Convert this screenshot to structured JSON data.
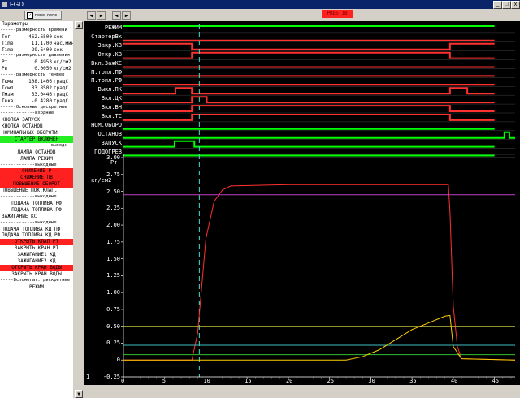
{
  "window": {
    "title": "FGD",
    "minimize": "_",
    "maximize": "□",
    "close": "x"
  },
  "toolbar": {
    "check_label": "none none",
    "check_mark": "✓",
    "nav_prev": "◀",
    "nav_next": "▶",
    "alarm": "PRES 1B"
  },
  "params": [
    {
      "t": "text",
      "text": "Параметры"
    },
    {
      "t": "sep",
      "text": "------размерность времени"
    },
    {
      "t": "kv",
      "label": "Тег",
      "value": "462.6500",
      "unit": "сек"
    },
    {
      "t": "kv",
      "label": "Time",
      "value": "11.1700",
      "unit": "час.мин"
    },
    {
      "t": "kv",
      "label": "Time",
      "value": "29.6400",
      "unit": "сек"
    },
    {
      "t": "sep",
      "text": "------размерность давления"
    },
    {
      "t": "kv",
      "label": "Pт",
      "value": "0.4953",
      "unit": "кг/см2"
    },
    {
      "t": "kv",
      "label": "Pв",
      "value": "0.0050",
      "unit": "кг/см2"
    },
    {
      "t": "sep",
      "text": "------размерность темпер"
    },
    {
      "t": "kv",
      "label": "Ткмз",
      "value": "108.1406",
      "unit": "градС"
    },
    {
      "t": "kv",
      "label": "Тсмл",
      "value": "33.8502",
      "unit": "градС"
    },
    {
      "t": "kv",
      "label": "Тмзм",
      "value": "53.0446",
      "unit": "градС"
    },
    {
      "t": "kv",
      "label": "Твкз",
      "value": "-0.4280",
      "unit": "градС"
    },
    {
      "t": "sep",
      "text": "------Основные дискретные"
    },
    {
      "t": "sep",
      "text": "-------------входные"
    },
    {
      "t": "text",
      "text": "КНОПКА         ЗАПУСК"
    },
    {
      "t": "text",
      "text": "КНОПКА         ОСТАНОВ"
    },
    {
      "t": "text",
      "text": "НОМИНАЛЬНЫХ ОБОРОТИ"
    },
    {
      "t": "green",
      "text": "СТАРТЕР ВКЛЮЧЕН"
    },
    {
      "t": "sep",
      "text": "-------------------выходн"
    },
    {
      "t": "center",
      "text": "ЛАМПА ОСТАНОВ"
    },
    {
      "t": "center",
      "text": "ЛАМПА РЕЖИМ"
    },
    {
      "t": "sep",
      "text": "-------------выходные"
    },
    {
      "t": "red",
      "text": "СНИЖЕНИЕ Р"
    },
    {
      "t": "red",
      "text": "СНИЖЕНИЕ ПВ"
    },
    {
      "t": "red",
      "text": "ПОВЫШЕНИЕ ОБОРОТ"
    },
    {
      "t": "text",
      "text": "ПОВЫШЕНИЕ ПОК.КЛАП."
    },
    {
      "t": "sep",
      "text": "-------------выходные"
    },
    {
      "t": "center",
      "text": "ПОДАЧА ТОПЛИВА РФ"
    },
    {
      "t": "center",
      "text": "ПОДАЧА ТОПЛИВА ПФ"
    },
    {
      "t": "text",
      "text": "ЗАЖИГАНИЕ КС"
    },
    {
      "t": "sep",
      "text": "-------------выходные"
    },
    {
      "t": "text",
      "text": "ПОДАЧА ТОПЛИВА КД ПФ"
    },
    {
      "t": "text",
      "text": "ПОДАЧА ТОПЛИВА КД РФ"
    },
    {
      "t": "red",
      "text": "ОТКРЫТЬ КЛАП РТ"
    },
    {
      "t": "center",
      "text": "ЗАКРЫТЬ КРАН РТ"
    },
    {
      "t": "center",
      "text": "ЗАЖИГАНИЕ1 КД"
    },
    {
      "t": "center",
      "text": "ЗАЖИГАНИЕ2 КД"
    },
    {
      "t": "red",
      "text": "ОТКРЫТЬ КРАН ВОДЫ"
    },
    {
      "t": "center",
      "text": "ЗАКРЫТЬ КРАН ВОДЫ"
    },
    {
      "t": "sep",
      "text": "-----Вспомогат. дискретные"
    },
    {
      "t": "center",
      "text": "РЕЖИМ"
    }
  ],
  "chart_data": {
    "type": "line",
    "discrete_labels": [
      "РЕЖИМ",
      "СтартерВк",
      "Закр.КВ",
      "Откр.КВ",
      "Вкл.ЗажКС",
      "П.топл.ПФ",
      "П.топл.РФ",
      "Выкл.ПК",
      "Вкл.ЦК",
      "Вкл.ВН",
      "Вкл.ТС",
      "НОМ.ОБОРО",
      "ОСТАНОВ",
      "ЗАПУСК",
      "ПОДОГРЕВ"
    ],
    "discrete_colors": [
      "#00ff00",
      "#ff3030",
      "#ff3030",
      "#ff3030",
      "#ff3030",
      "#ff3030",
      "#ff3030",
      "#ff3030",
      "#ff3030",
      "#ff3030",
      "#ff3030",
      "#00ff00",
      "#00ff00",
      "#00ff00",
      "#00ff00"
    ],
    "discrete_signals": [
      {
        "state": [
          [
            0,
            45,
            1
          ]
        ]
      },
      {
        "state": [
          [
            0,
            45,
            0
          ]
        ]
      },
      {
        "state": [
          [
            0,
            8.3,
            1
          ],
          [
            8.3,
            39.6,
            0
          ],
          [
            39.6,
            45,
            1
          ]
        ]
      },
      {
        "state": [
          [
            0,
            8.3,
            0
          ],
          [
            8.3,
            39.6,
            1
          ],
          [
            39.6,
            45,
            0
          ]
        ]
      },
      {
        "state": [
          [
            0,
            45,
            0
          ]
        ]
      },
      {
        "state": [
          [
            0,
            45,
            0
          ]
        ]
      },
      {
        "state": [
          [
            0,
            45,
            0
          ]
        ]
      },
      {
        "state": [
          [
            0,
            6.3,
            0
          ],
          [
            6.3,
            8.3,
            1
          ],
          [
            8.3,
            39.6,
            0
          ],
          [
            39.6,
            41.7,
            1
          ],
          [
            41.7,
            45,
            0
          ]
        ]
      },
      {
        "state": [
          [
            0,
            8.3,
            0
          ],
          [
            8.3,
            10.1,
            1
          ],
          [
            10.1,
            45,
            0
          ]
        ]
      },
      {
        "state": [
          [
            0,
            8.3,
            0
          ],
          [
            8.3,
            39.6,
            1
          ],
          [
            39.6,
            45,
            0
          ]
        ]
      },
      {
        "state": [
          [
            0,
            8.3,
            0
          ],
          [
            8.3,
            39.6,
            1
          ],
          [
            39.6,
            45,
            0
          ]
        ]
      },
      {
        "state": [
          [
            0,
            45,
            0
          ]
        ]
      },
      {
        "state": [
          [
            0,
            46.2,
            0
          ],
          [
            46.2,
            46.8,
            1
          ],
          [
            46.8,
            47.5,
            0
          ]
        ]
      },
      {
        "state": [
          [
            0,
            6.2,
            0
          ],
          [
            6.2,
            8.6,
            1
          ],
          [
            8.6,
            45,
            0
          ]
        ]
      },
      {
        "state": [
          [
            0,
            45,
            0
          ]
        ]
      }
    ],
    "analog_ylabel": "Pт",
    "analog_unit": "кг/см2",
    "y_ticks": [
      "3.00",
      "2.75",
      "2.50",
      "2.25",
      "2.00",
      "1.75",
      "1.50",
      "1.25",
      "1.00",
      "0.75",
      "0.50",
      "0.25",
      "0",
      "-0.25"
    ],
    "ylim": [
      -0.25,
      3.0
    ],
    "x_ticks": [
      "0",
      "5",
      "10",
      "15",
      "20",
      "25",
      "30",
      "35",
      "40",
      "45"
    ],
    "xlim": [
      0,
      47.5
    ],
    "bottom_left_marker": "1",
    "cursor_x": 9.2,
    "series": [
      {
        "color": "#ff3030",
        "points": [
          [
            0,
            0
          ],
          [
            8.3,
            0
          ],
          [
            9.0,
            0.4
          ],
          [
            10,
            1.8
          ],
          [
            11,
            2.35
          ],
          [
            12,
            2.52
          ],
          [
            13,
            2.58
          ],
          [
            20,
            2.6
          ],
          [
            39.4,
            2.6
          ],
          [
            39.6,
            2.2
          ],
          [
            40,
            0.8
          ],
          [
            40.5,
            0.2
          ],
          [
            41,
            0.02
          ],
          [
            47.5,
            0
          ]
        ]
      },
      {
        "color": "#c040c0",
        "points": [
          [
            0,
            2.45
          ],
          [
            47.5,
            2.45
          ]
        ]
      },
      {
        "color": "#c0c040",
        "points": [
          [
            0,
            0.5
          ],
          [
            47.5,
            0.5
          ]
        ]
      },
      {
        "color": "#40c0c0",
        "points": [
          [
            0,
            0.22
          ],
          [
            47.5,
            0.22
          ]
        ]
      },
      {
        "color": "#30c030",
        "points": [
          [
            0,
            0.08
          ],
          [
            47.5,
            0.08
          ]
        ]
      },
      {
        "color": "#ffd000",
        "points": [
          [
            0,
            0
          ],
          [
            27,
            0
          ],
          [
            29,
            0.05
          ],
          [
            31,
            0.15
          ],
          [
            33,
            0.3
          ],
          [
            35,
            0.45
          ],
          [
            37,
            0.55
          ],
          [
            39,
            0.65
          ],
          [
            39.6,
            0.66
          ],
          [
            40,
            0.2
          ],
          [
            41,
            0.02
          ],
          [
            47.5,
            0
          ]
        ]
      }
    ]
  }
}
